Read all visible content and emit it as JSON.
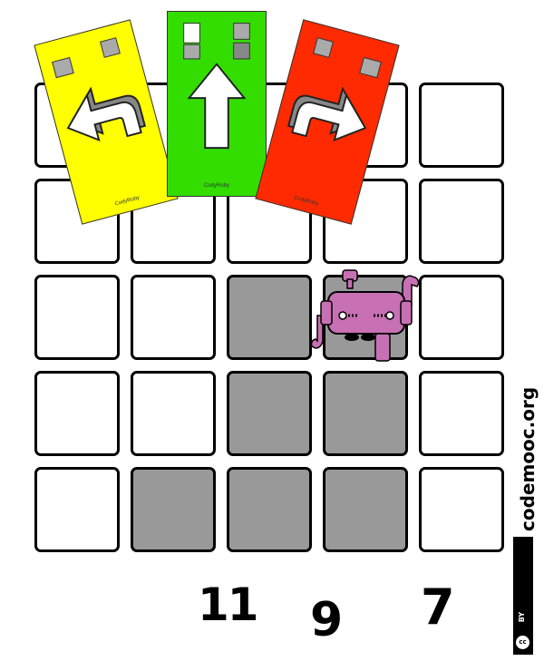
{
  "board": {
    "columns": 5,
    "rows": 5,
    "path_cells": [
      [
        2,
        2
      ],
      [
        2,
        3
      ],
      [
        3,
        2
      ],
      [
        3,
        3
      ],
      [
        4,
        1
      ],
      [
        4,
        2
      ],
      [
        4,
        3
      ]
    ]
  },
  "robot": {
    "name": "robot-character",
    "color": "#c870b4"
  },
  "cards": [
    {
      "name": "card-turn-left",
      "color": "#ffff00",
      "label": "CodyRoby",
      "icon": "turn-left-arrow"
    },
    {
      "name": "card-forward",
      "color": "#33dd00",
      "label": "CodyRoby",
      "icon": "forward-arrow"
    },
    {
      "name": "card-turn-right",
      "color": "#ff2a00",
      "label": "CodyRoby",
      "icon": "turn-right-arrow"
    }
  ],
  "counts": {
    "left": "11",
    "middle": "9",
    "right": "7"
  },
  "site": "codemooc.org",
  "license": {
    "cc": "cc",
    "by": "BY"
  }
}
